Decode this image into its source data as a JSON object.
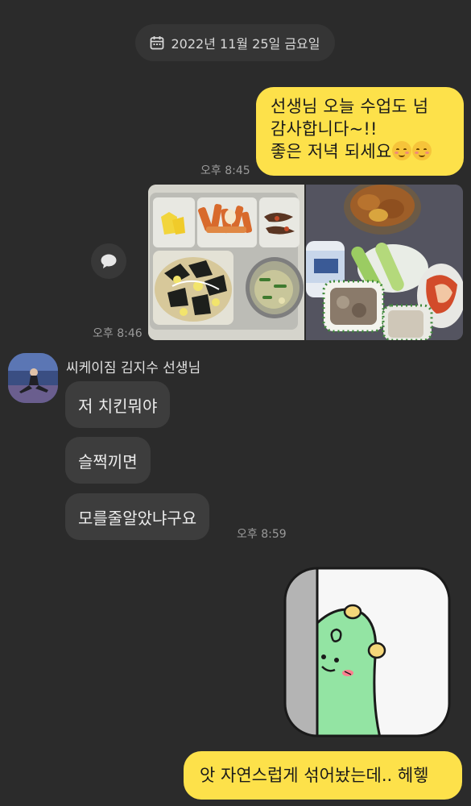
{
  "date_separator": {
    "text": "2022년 11월 25일 금요일",
    "icon": "calendar-icon"
  },
  "messages": {
    "outgoing_1": {
      "lines": [
        "선생님 오늘 수업도 넘",
        "감사합니다~!!",
        "좋은 저녁 되세요"
      ],
      "emoji": "smiling-face-icon",
      "time": "오후 8:45"
    },
    "outgoing_images": {
      "time": "오후 8:46",
      "images": [
        "school-lunch-tray-photo",
        "home-dinner-table-photo"
      ]
    },
    "incoming": {
      "sender": "씨케이짐 김지수 선생님",
      "bubbles": [
        "저 치킨뭐야",
        "슬쩍끼면",
        "모를줄알았냐구요"
      ],
      "time": "오후 8:59"
    },
    "outgoing_sticker": {
      "sticker": "green-dino-peeking-sticker"
    },
    "outgoing_2": {
      "text": "앗 자연스럽게 섞어놨는데.. 헤헿"
    }
  },
  "colors": {
    "background": "#2b2b2b",
    "outgoing_bubble": "#fde14a",
    "incoming_bubble": "#3d3d3d",
    "timestamp": "#9a9a9a"
  }
}
